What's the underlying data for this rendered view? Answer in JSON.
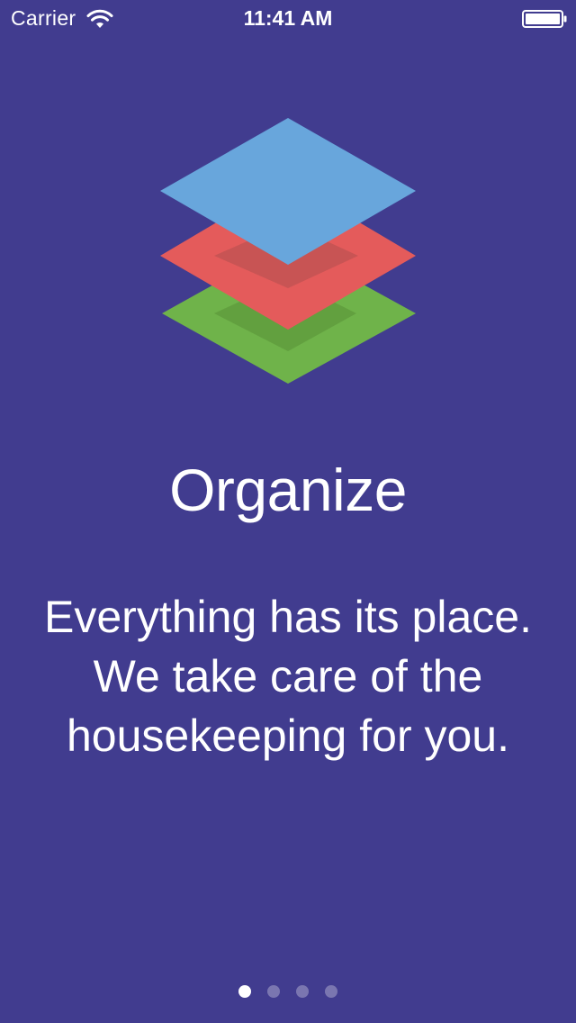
{
  "status_bar": {
    "carrier": "Carrier",
    "time": "11:41 AM",
    "wifi_icon": "wifi-icon",
    "battery_icon": "battery-icon"
  },
  "illustration": {
    "icon": "stacked-layers-icon",
    "colors": {
      "top": "#68a6dc",
      "middle": "#e45b5b",
      "bottom": "#6fb34a",
      "background": "#413c8f"
    }
  },
  "title": "Organize",
  "description": {
    "lines": [
      "Everything has its place.",
      "We take care of the",
      "housekeeping for you."
    ]
  },
  "page_control": {
    "pages": 4,
    "current_page": 1
  }
}
